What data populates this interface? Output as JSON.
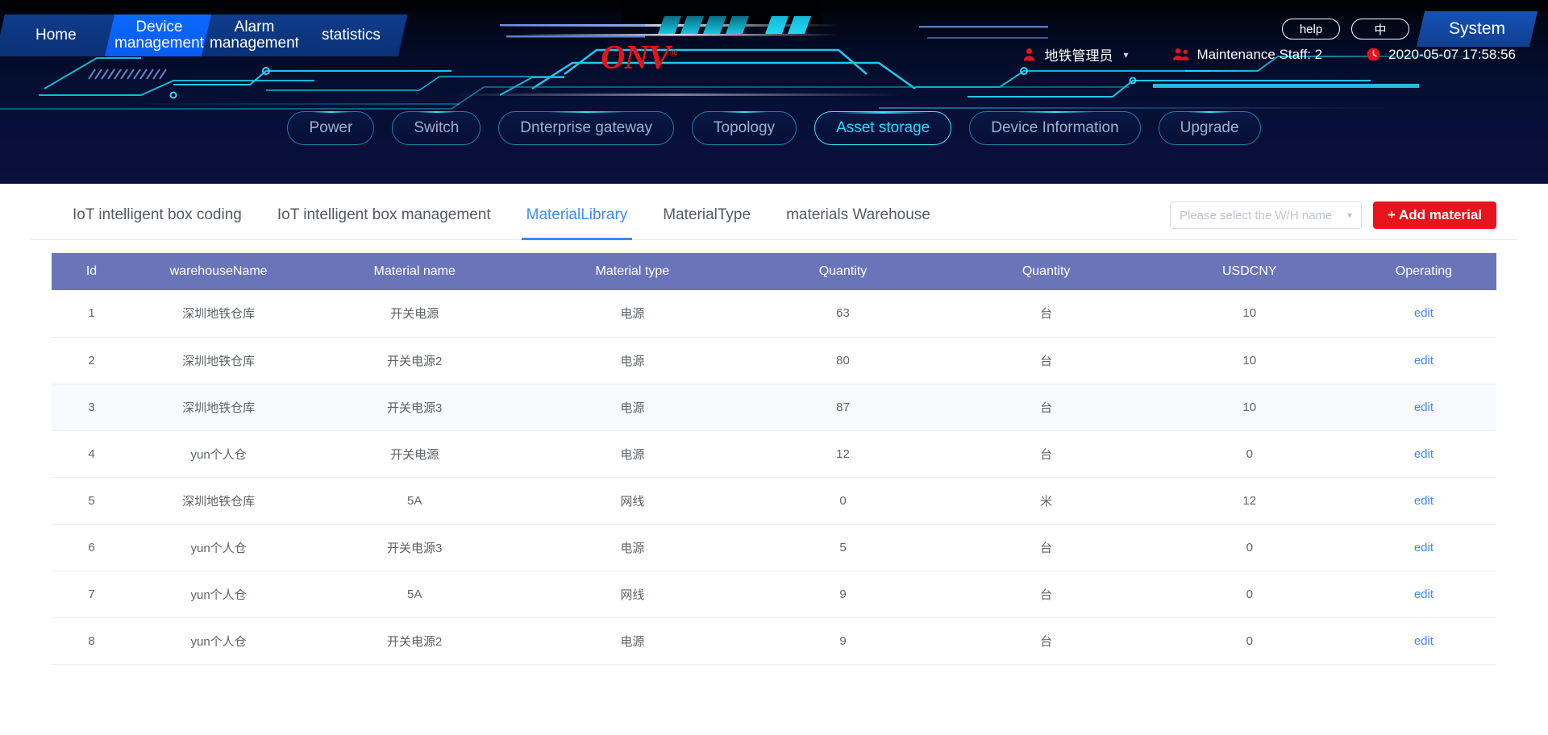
{
  "header": {
    "primary_nav": [
      {
        "label": "Home",
        "active": false
      },
      {
        "label": "Device\nmanagement",
        "active": true
      },
      {
        "label": "Alarm\nmanagement",
        "active": false
      },
      {
        "label": "statistics",
        "active": false
      }
    ],
    "logo_text": "ONV",
    "logo_reg": "®",
    "help_label": "help",
    "lang_label": "中",
    "system_label": "System",
    "user_name": "地铁管理员",
    "maintenance_staff": "Maintenance Staff: 2",
    "datetime": "2020-05-07 17:58:56",
    "secondary_nav": [
      {
        "label": "Power",
        "active": false
      },
      {
        "label": "Switch",
        "active": false
      },
      {
        "label": "Dnterprise gateway",
        "active": false
      },
      {
        "label": "Topology",
        "active": false
      },
      {
        "label": "Asset storage",
        "active": true
      },
      {
        "label": "Device Information",
        "active": false
      },
      {
        "label": "Upgrade",
        "active": false
      }
    ]
  },
  "panel": {
    "tabs": [
      {
        "label": "IoT intelligent box coding",
        "active": false
      },
      {
        "label": "IoT intelligent box management",
        "active": false
      },
      {
        "label": "MaterialLibrary",
        "active": true
      },
      {
        "label": "MaterialType",
        "active": false
      },
      {
        "label": "materials Warehouse",
        "active": false
      }
    ],
    "warehouse_select_placeholder": "Please select the W/H name",
    "add_button_label": "+ Add material",
    "table": {
      "columns": [
        "Id",
        "warehouseName",
        "Material name",
        "Material type",
        "Quantity",
        "Quantity",
        "USDCNY",
        "Operating"
      ],
      "edit_label": "edit",
      "rows": [
        {
          "id": "1",
          "warehouse": "深圳地铁仓库",
          "material_name": "开关电源",
          "material_type": "电源",
          "quantity": "63",
          "unit": "台",
          "usdcny": "10"
        },
        {
          "id": "2",
          "warehouse": "深圳地铁仓库",
          "material_name": "开关电源2",
          "material_type": "电源",
          "quantity": "80",
          "unit": "台",
          "usdcny": "10"
        },
        {
          "id": "3",
          "warehouse": "深圳地铁仓库",
          "material_name": "开关电源3",
          "material_type": "电源",
          "quantity": "87",
          "unit": "台",
          "usdcny": "10"
        },
        {
          "id": "4",
          "warehouse": "yun个人仓",
          "material_name": "开关电源",
          "material_type": "电源",
          "quantity": "12",
          "unit": "台",
          "usdcny": "0"
        },
        {
          "id": "5",
          "warehouse": "深圳地铁仓库",
          "material_name": "5A",
          "material_type": "网线",
          "quantity": "0",
          "unit": "米",
          "usdcny": "12"
        },
        {
          "id": "6",
          "warehouse": "yun个人仓",
          "material_name": "开关电源3",
          "material_type": "电源",
          "quantity": "5",
          "unit": "台",
          "usdcny": "0"
        },
        {
          "id": "7",
          "warehouse": "yun个人仓",
          "material_name": "5A",
          "material_type": "网线",
          "quantity": "9",
          "unit": "台",
          "usdcny": "0"
        },
        {
          "id": "8",
          "warehouse": "yun个人仓",
          "material_name": "开关电源2",
          "material_type": "电源",
          "quantity": "9",
          "unit": "台",
          "usdcny": "0"
        }
      ]
    }
  },
  "colors": {
    "accent_red": "#e8131d",
    "accent_blue": "#3e8bf5",
    "table_header": "#6b74b8",
    "cyan": "#21dcff"
  }
}
